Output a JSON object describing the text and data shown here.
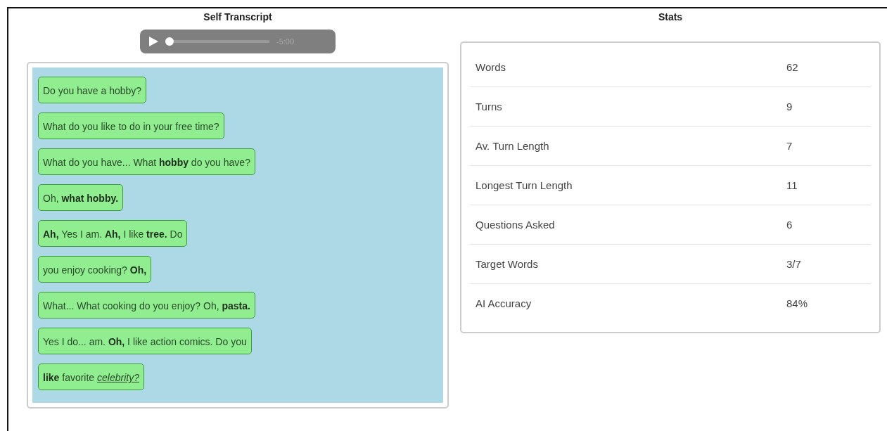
{
  "transcript": {
    "title": "Self Transcript",
    "player": {
      "level": 0,
      "time": "-5:00"
    },
    "turns": [
      {
        "text": "Do you have a hobby?"
      },
      {
        "text": "What do you like to do in your free time?"
      },
      {
        "text": "What do you have... What **hobby** do you have?"
      },
      {
        "text": "Oh, **what hobby.**"
      },
      {
        "text": "**Ah,** Yes I am. **Ah,** I like **tree.** Do"
      },
      {
        "text": "you enjoy cooking? **Oh,**"
      },
      {
        "text": "What... What cooking do you enjoy? Oh, **pasta.**"
      },
      {
        "text": "Yes I do... am. **Oh,** I like action comics. Do you"
      },
      {
        "text": "**like** favorite *celebrity?*"
      }
    ]
  },
  "stats": {
    "title": "Stats",
    "rows": [
      {
        "label": "Words",
        "value": "62"
      },
      {
        "label": "Turns",
        "value": "9"
      },
      {
        "label": "Av. Turn Length",
        "value": "7"
      },
      {
        "label": "Longest Turn Length",
        "value": "11"
      },
      {
        "label": "Questions Asked",
        "value": "6"
      },
      {
        "label": "Target Words",
        "value": "3/7"
      },
      {
        "label": "AI Accuracy",
        "value": "84%"
      }
    ]
  }
}
